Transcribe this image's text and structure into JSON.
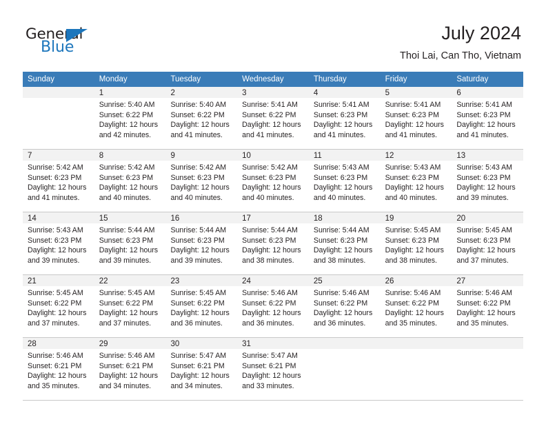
{
  "brand": {
    "name_dark": "General",
    "name_blue": "Blue",
    "triangle_color": "#1c76bc",
    "blue_color": "#1c76bc"
  },
  "header": {
    "title": "July 2024",
    "subtitle": "Thoi Lai, Can Tho, Vietnam",
    "header_bg_color": "#3a7cb8",
    "header_text_color": "#ffffff",
    "daynum_bg_color": "#f2f2f2",
    "grid_line_color": "#c8c8c8"
  },
  "weekdays": [
    "Sunday",
    "Monday",
    "Tuesday",
    "Wednesday",
    "Thursday",
    "Friday",
    "Saturday"
  ],
  "weeks": [
    [
      {
        "day": "",
        "lines": [
          "",
          "",
          "",
          ""
        ]
      },
      {
        "day": "1",
        "lines": [
          "Sunrise: 5:40 AM",
          "Sunset: 6:22 PM",
          "Daylight: 12 hours",
          "and 42 minutes."
        ]
      },
      {
        "day": "2",
        "lines": [
          "Sunrise: 5:40 AM",
          "Sunset: 6:22 PM",
          "Daylight: 12 hours",
          "and 41 minutes."
        ]
      },
      {
        "day": "3",
        "lines": [
          "Sunrise: 5:41 AM",
          "Sunset: 6:22 PM",
          "Daylight: 12 hours",
          "and 41 minutes."
        ]
      },
      {
        "day": "4",
        "lines": [
          "Sunrise: 5:41 AM",
          "Sunset: 6:23 PM",
          "Daylight: 12 hours",
          "and 41 minutes."
        ]
      },
      {
        "day": "5",
        "lines": [
          "Sunrise: 5:41 AM",
          "Sunset: 6:23 PM",
          "Daylight: 12 hours",
          "and 41 minutes."
        ]
      },
      {
        "day": "6",
        "lines": [
          "Sunrise: 5:41 AM",
          "Sunset: 6:23 PM",
          "Daylight: 12 hours",
          "and 41 minutes."
        ]
      }
    ],
    [
      {
        "day": "7",
        "lines": [
          "Sunrise: 5:42 AM",
          "Sunset: 6:23 PM",
          "Daylight: 12 hours",
          "and 41 minutes."
        ]
      },
      {
        "day": "8",
        "lines": [
          "Sunrise: 5:42 AM",
          "Sunset: 6:23 PM",
          "Daylight: 12 hours",
          "and 40 minutes."
        ]
      },
      {
        "day": "9",
        "lines": [
          "Sunrise: 5:42 AM",
          "Sunset: 6:23 PM",
          "Daylight: 12 hours",
          "and 40 minutes."
        ]
      },
      {
        "day": "10",
        "lines": [
          "Sunrise: 5:42 AM",
          "Sunset: 6:23 PM",
          "Daylight: 12 hours",
          "and 40 minutes."
        ]
      },
      {
        "day": "11",
        "lines": [
          "Sunrise: 5:43 AM",
          "Sunset: 6:23 PM",
          "Daylight: 12 hours",
          "and 40 minutes."
        ]
      },
      {
        "day": "12",
        "lines": [
          "Sunrise: 5:43 AM",
          "Sunset: 6:23 PM",
          "Daylight: 12 hours",
          "and 40 minutes."
        ]
      },
      {
        "day": "13",
        "lines": [
          "Sunrise: 5:43 AM",
          "Sunset: 6:23 PM",
          "Daylight: 12 hours",
          "and 39 minutes."
        ]
      }
    ],
    [
      {
        "day": "14",
        "lines": [
          "Sunrise: 5:43 AM",
          "Sunset: 6:23 PM",
          "Daylight: 12 hours",
          "and 39 minutes."
        ]
      },
      {
        "day": "15",
        "lines": [
          "Sunrise: 5:44 AM",
          "Sunset: 6:23 PM",
          "Daylight: 12 hours",
          "and 39 minutes."
        ]
      },
      {
        "day": "16",
        "lines": [
          "Sunrise: 5:44 AM",
          "Sunset: 6:23 PM",
          "Daylight: 12 hours",
          "and 39 minutes."
        ]
      },
      {
        "day": "17",
        "lines": [
          "Sunrise: 5:44 AM",
          "Sunset: 6:23 PM",
          "Daylight: 12 hours",
          "and 38 minutes."
        ]
      },
      {
        "day": "18",
        "lines": [
          "Sunrise: 5:44 AM",
          "Sunset: 6:23 PM",
          "Daylight: 12 hours",
          "and 38 minutes."
        ]
      },
      {
        "day": "19",
        "lines": [
          "Sunrise: 5:45 AM",
          "Sunset: 6:23 PM",
          "Daylight: 12 hours",
          "and 38 minutes."
        ]
      },
      {
        "day": "20",
        "lines": [
          "Sunrise: 5:45 AM",
          "Sunset: 6:23 PM",
          "Daylight: 12 hours",
          "and 37 minutes."
        ]
      }
    ],
    [
      {
        "day": "21",
        "lines": [
          "Sunrise: 5:45 AM",
          "Sunset: 6:22 PM",
          "Daylight: 12 hours",
          "and 37 minutes."
        ]
      },
      {
        "day": "22",
        "lines": [
          "Sunrise: 5:45 AM",
          "Sunset: 6:22 PM",
          "Daylight: 12 hours",
          "and 37 minutes."
        ]
      },
      {
        "day": "23",
        "lines": [
          "Sunrise: 5:45 AM",
          "Sunset: 6:22 PM",
          "Daylight: 12 hours",
          "and 36 minutes."
        ]
      },
      {
        "day": "24",
        "lines": [
          "Sunrise: 5:46 AM",
          "Sunset: 6:22 PM",
          "Daylight: 12 hours",
          "and 36 minutes."
        ]
      },
      {
        "day": "25",
        "lines": [
          "Sunrise: 5:46 AM",
          "Sunset: 6:22 PM",
          "Daylight: 12 hours",
          "and 36 minutes."
        ]
      },
      {
        "day": "26",
        "lines": [
          "Sunrise: 5:46 AM",
          "Sunset: 6:22 PM",
          "Daylight: 12 hours",
          "and 35 minutes."
        ]
      },
      {
        "day": "27",
        "lines": [
          "Sunrise: 5:46 AM",
          "Sunset: 6:22 PM",
          "Daylight: 12 hours",
          "and 35 minutes."
        ]
      }
    ],
    [
      {
        "day": "28",
        "lines": [
          "Sunrise: 5:46 AM",
          "Sunset: 6:21 PM",
          "Daylight: 12 hours",
          "and 35 minutes."
        ]
      },
      {
        "day": "29",
        "lines": [
          "Sunrise: 5:46 AM",
          "Sunset: 6:21 PM",
          "Daylight: 12 hours",
          "and 34 minutes."
        ]
      },
      {
        "day": "30",
        "lines": [
          "Sunrise: 5:47 AM",
          "Sunset: 6:21 PM",
          "Daylight: 12 hours",
          "and 34 minutes."
        ]
      },
      {
        "day": "31",
        "lines": [
          "Sunrise: 5:47 AM",
          "Sunset: 6:21 PM",
          "Daylight: 12 hours",
          "and 33 minutes."
        ]
      },
      {
        "day": "",
        "lines": [
          "",
          "",
          "",
          ""
        ]
      },
      {
        "day": "",
        "lines": [
          "",
          "",
          "",
          ""
        ]
      },
      {
        "day": "",
        "lines": [
          "",
          "",
          "",
          ""
        ]
      }
    ]
  ]
}
